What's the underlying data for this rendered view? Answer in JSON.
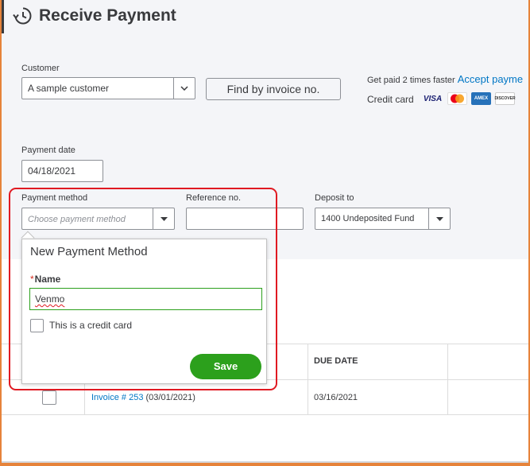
{
  "page": {
    "title": "Receive Payment"
  },
  "customer": {
    "label": "Customer",
    "value": "A sample customer"
  },
  "find_button": "Find by invoice no.",
  "get_paid": {
    "text": "Get paid 2 times faster",
    "link": "Accept payme"
  },
  "credit_card": {
    "label": "Credit card",
    "cards": [
      "VISA",
      "MasterCard",
      "AMERICAN EXPRESS",
      "DISCOVER"
    ]
  },
  "payment_date": {
    "label": "Payment date",
    "value": "04/18/2021"
  },
  "payment_method": {
    "label": "Payment method",
    "placeholder": "Choose payment method"
  },
  "reference": {
    "label": "Reference no.",
    "value": ""
  },
  "deposit_to": {
    "label": "Deposit to",
    "value": "1400 Undeposited Fund"
  },
  "popup": {
    "title": "New Payment Method",
    "required_mark": "*",
    "name_label": "Name",
    "name_value": "Venmo",
    "credit_card_checkbox": "This is a credit card",
    "save_label": "Save"
  },
  "table": {
    "headers": {
      "due_date": "DUE DATE"
    },
    "rows": [
      {
        "invoice_link": "Invoice # 253",
        "invoice_date": "(03/01/2021)",
        "due_date": "03/16/2021"
      }
    ]
  },
  "colors": {
    "accent_green": "#2ca01c",
    "link_blue": "#0077c5",
    "highlight_red": "#e01a22",
    "frame_orange": "#e6833a"
  }
}
